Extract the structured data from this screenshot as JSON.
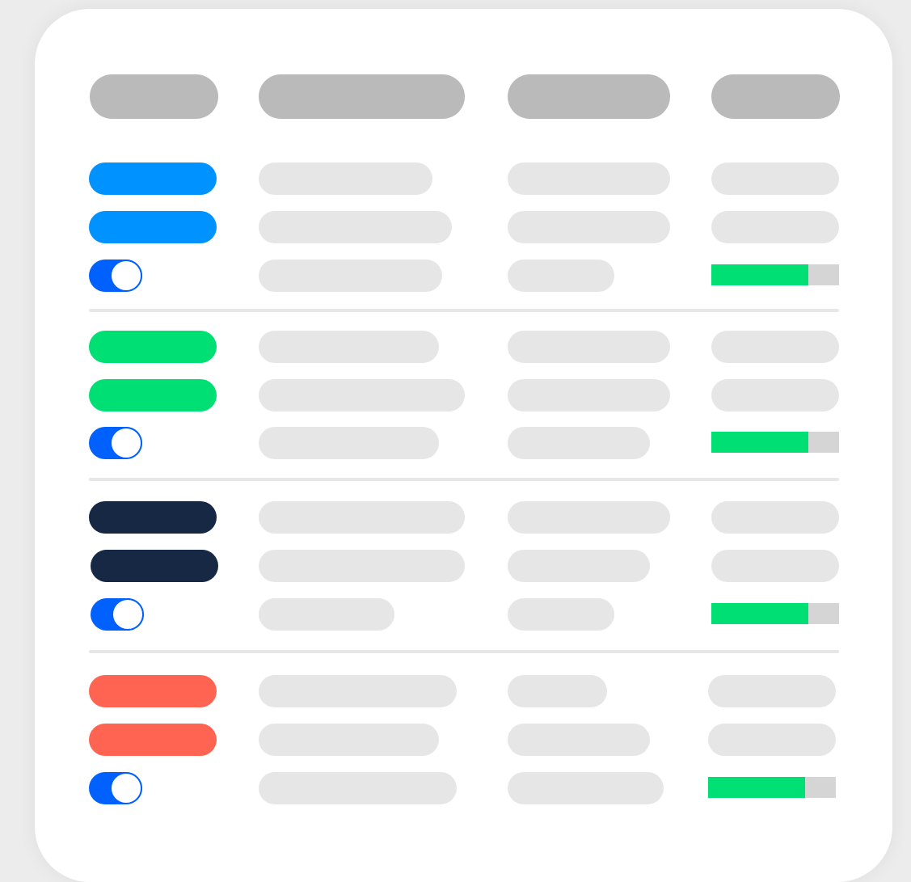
{
  "colors": {
    "header_placeholder": "#bababa",
    "text_placeholder": "#e6e6e6",
    "toggle_on": "#0061fe",
    "progress_fill": "#00df74",
    "progress_track": "#d5d5d5",
    "divider": "#e7e7e7"
  },
  "header_columns": 4,
  "groups": [
    {
      "label_color": "#0092ff",
      "toggle_state": "on",
      "progress": 0.76
    },
    {
      "label_color": "#00df74",
      "toggle_state": "on",
      "progress": 0.76
    },
    {
      "label_color": "#172844",
      "toggle_state": "on",
      "progress": 0.76
    },
    {
      "label_color": "#ff6453",
      "toggle_state": "on",
      "progress": 0.76
    }
  ]
}
